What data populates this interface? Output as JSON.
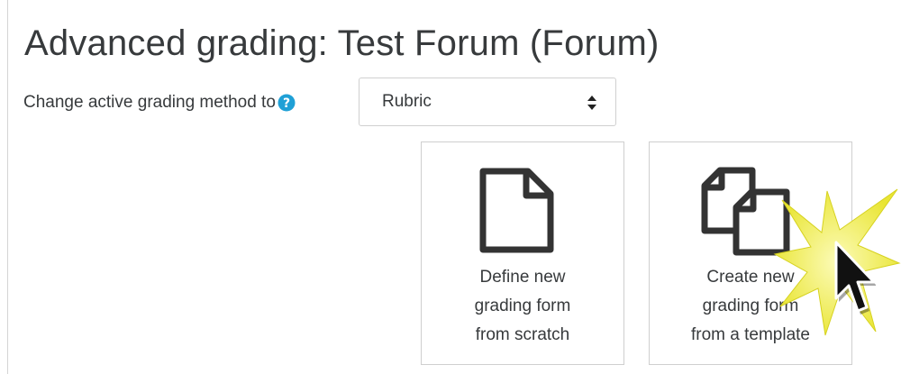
{
  "page": {
    "title": "Advanced grading: Test Forum (Forum)"
  },
  "grading_method": {
    "label": "Change active grading method to",
    "help_icon": "question-circle-icon",
    "selected": "Rubric"
  },
  "actions": [
    {
      "icon": "blank-document-icon",
      "lines": [
        "Define new",
        "grading form",
        "from scratch"
      ]
    },
    {
      "icon": "copy-documents-icon",
      "lines": [
        "Create new",
        "grading form",
        "from a template"
      ]
    }
  ],
  "colors": {
    "text": "#373a3c",
    "help_icon": "#1fa0d6",
    "icon_stroke": "#333333",
    "starburst": "#f3f04a"
  }
}
